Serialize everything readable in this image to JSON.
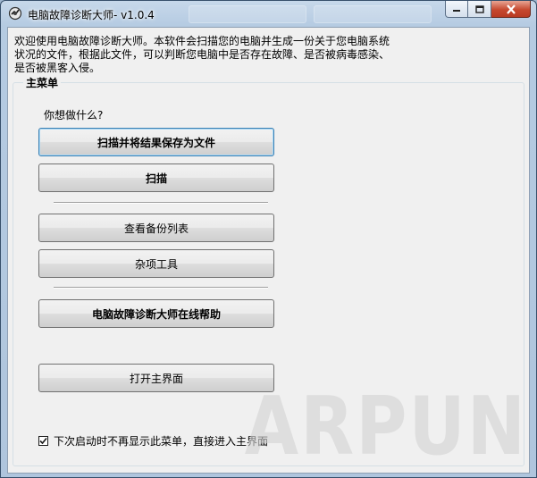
{
  "window": {
    "title": "电脑故障诊断大师- v1.0.4",
    "caption_buttons": [
      "minimize-icon",
      "maximize-icon",
      "close-icon"
    ]
  },
  "intro_text": "欢迎使用电脑故障诊断大师。本软件会扫描您的电脑并生成一份关于您电脑系统状况的文件，根据此文件，可以判断您电脑中是否存在故障、是否被病毒感染、是否被黑客入侵。",
  "main_menu": {
    "legend": "主菜单",
    "question": "你想做什么?",
    "buttons": {
      "scan_save": "扫描并将结果保存为文件",
      "scan": "扫描",
      "backup_list": "查看备份列表",
      "misc_tools": "杂项工具",
      "online_help": "电脑故障诊断大师在线帮助",
      "open_main": "打开主界面"
    },
    "skip_menu": {
      "checked": true,
      "label": "下次启动时不再显示此菜单，直接进入主界面"
    }
  },
  "watermark": "ARPUN"
}
